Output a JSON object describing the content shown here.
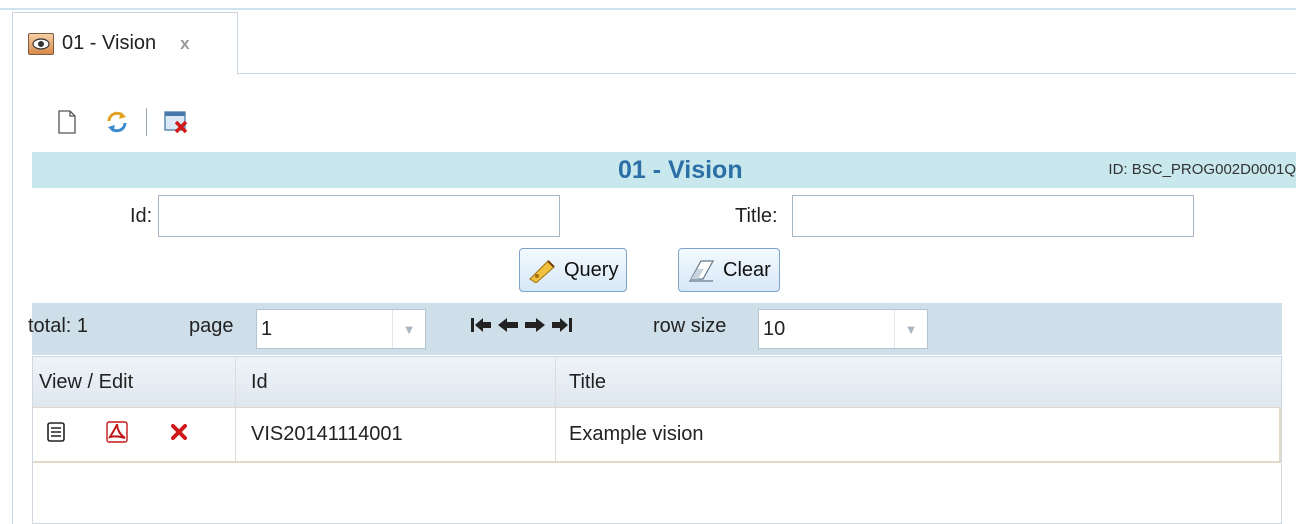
{
  "tab": {
    "label": "01 - Vision",
    "close": "x"
  },
  "toolbar": {
    "items": [
      "new-document",
      "refresh",
      "close-all"
    ]
  },
  "header": {
    "title": "01 - Vision",
    "program_id": "ID: BSC_PROG002D0001Q"
  },
  "form": {
    "id_label": "Id:",
    "id_value": "",
    "title_label": "Title:",
    "title_value": "",
    "query_label": "Query",
    "clear_label": "Clear"
  },
  "pager": {
    "total": "total: 1",
    "page_label": "page",
    "page_value": "1",
    "row_size_label": "row size",
    "row_size_value": "10"
  },
  "grid": {
    "columns": [
      "View / Edit",
      "Id",
      "Title"
    ],
    "rows": [
      {
        "id": "VIS20141114001",
        "title": "Example vision"
      }
    ]
  },
  "colors": {
    "title_band": "#c8e8ee",
    "title_text": "#2c6fa6",
    "pager_band": "#cfdfe9",
    "delete_icon": "#d01818"
  }
}
